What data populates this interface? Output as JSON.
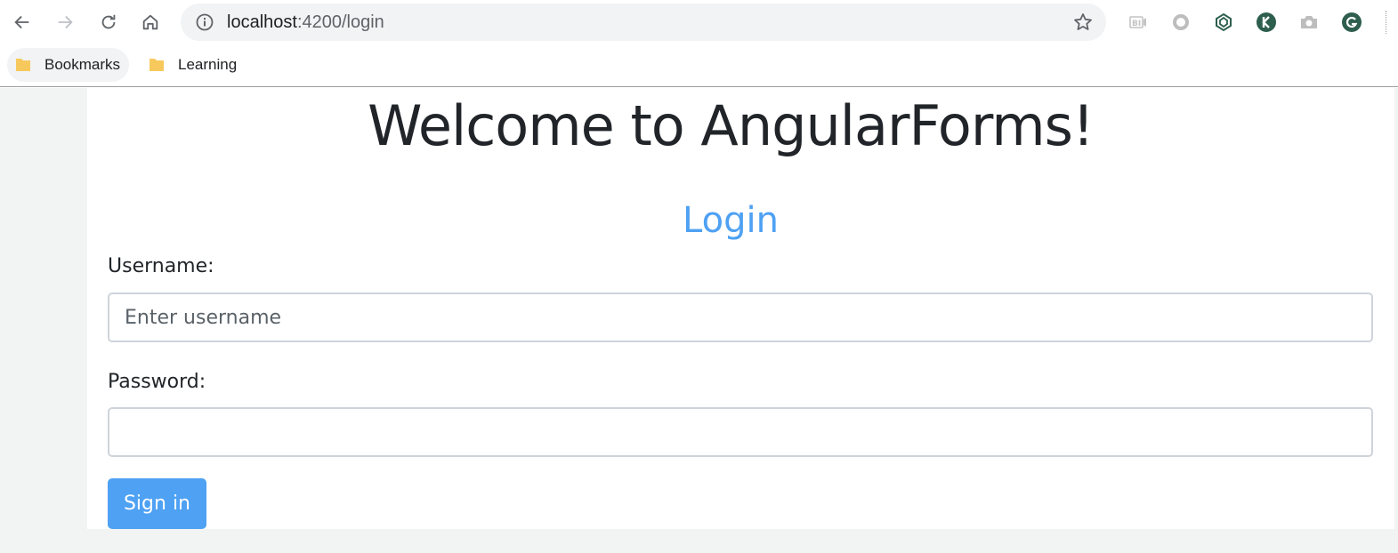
{
  "browser": {
    "url_host": "localhost",
    "url_path": ":4200/login",
    "bookmarks": [
      {
        "label": "Bookmarks"
      },
      {
        "label": "Learning"
      }
    ],
    "extension_icons": [
      "bi-extension-icon",
      "circle-extension-icon",
      "spiral-extension-icon",
      "k-extension-icon",
      "camera-extension-icon",
      "grammarly-icon"
    ],
    "colors": {
      "folder": "#f7c95c",
      "extension_dark": "#2e5e4e"
    }
  },
  "page": {
    "title": "Welcome to AngularForms!",
    "form": {
      "heading": "Login",
      "username_label": "Username:",
      "username_placeholder": "Enter username",
      "password_label": "Password:",
      "password_placeholder": "",
      "submit_label": "Sign in"
    },
    "colors": {
      "accent": "#4ea1f3",
      "text": "#212529",
      "background": "#f2f4f3"
    }
  }
}
